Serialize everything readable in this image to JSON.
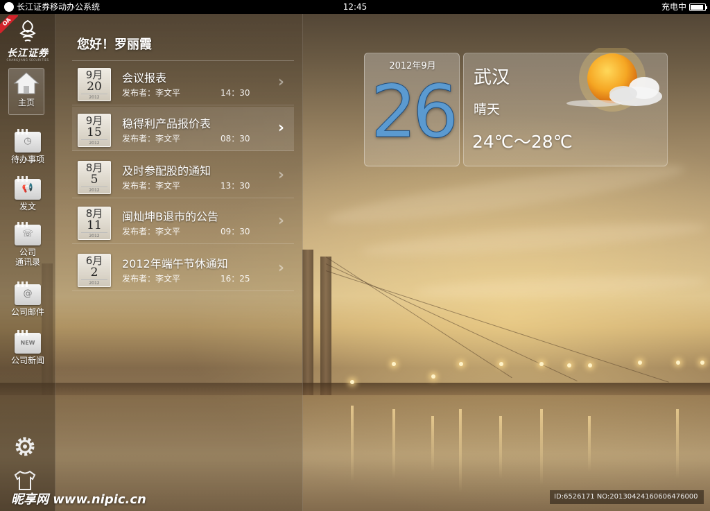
{
  "status_bar": {
    "app_title": "长江证券移动办公系统",
    "time": "12:45",
    "charging": "充电中",
    "battery_level": 0.9
  },
  "brand": {
    "ribbon": "OA",
    "name": "长江证券",
    "sub": "CHANGJIANG SECURITIES"
  },
  "nav": {
    "home": "主页",
    "todo": "待办事项",
    "dispatch": "发文",
    "contacts_line1": "公司",
    "contacts_line2": "通讯录",
    "mail": "公司邮件",
    "news": "公司新闻",
    "news_badge": "NEW"
  },
  "greeting": "您好！罗丽霞",
  "notices": [
    {
      "month": "9月",
      "day": "20",
      "year": "2012",
      "title": "会议报表",
      "author": "发布者：李文平",
      "time": "14：30"
    },
    {
      "month": "9月",
      "day": "15",
      "year": "2012",
      "title": "稳得利产品报价表",
      "author": "发布者：李文平",
      "time": "08：30"
    },
    {
      "month": "8月",
      "day": "5",
      "year": "2012",
      "title": "及时参配股的通知",
      "author": "发布者：李文平",
      "time": "13：30"
    },
    {
      "month": "8月",
      "day": "11",
      "year": "2012",
      "title": "闽灿坤B退市的公告",
      "author": "发布者：李文平",
      "time": "09：30"
    },
    {
      "month": "6月",
      "day": "2",
      "year": "2012",
      "title": "2012年端午节休通知",
      "author": "发布者：李文平",
      "time": "16：25"
    }
  ],
  "calendar": {
    "year_month": "2012年9月",
    "day": "26"
  },
  "weather": {
    "city": "武汉",
    "condition": "晴天",
    "temperature": "24℃～28℃",
    "icon": "sun-cloud-icon"
  },
  "footer": {
    "watermark": "昵享网 www.nipic.cn",
    "id_text": "ID:6526171 NO:20130424160606476000"
  },
  "colors": {
    "calendar_digit": "#5b9ad0",
    "sun": "#f5a623",
    "ribbon": "#d2232a"
  }
}
